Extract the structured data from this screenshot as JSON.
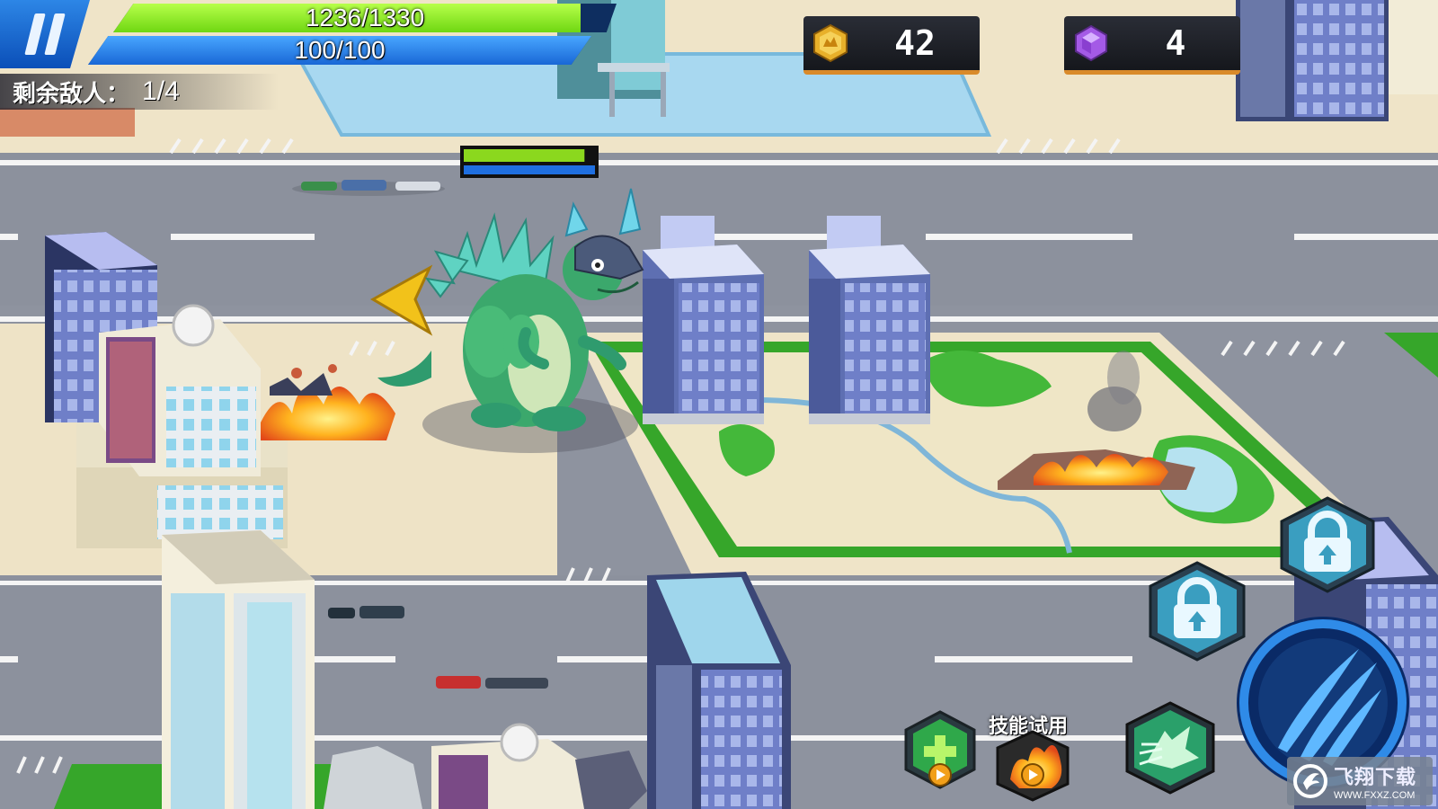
{
  "hud": {
    "hp": {
      "current": 1236,
      "max": 1330,
      "text": "1236/1330",
      "fraction": 0.929
    },
    "mp": {
      "current": 100,
      "max": 100,
      "text": "100/100",
      "fraction": 1.0
    },
    "enemies": {
      "label": "剩余敌人：",
      "value": "1/4"
    }
  },
  "currency": {
    "gold": {
      "icon": "gold-coin-icon",
      "value": "42"
    },
    "gems": {
      "icon": "purple-gem-icon",
      "value": "4"
    }
  },
  "player": {
    "hp_fraction": 0.92,
    "mp_fraction": 1.0
  },
  "skills": {
    "trial_label": "技能试用",
    "heal": {
      "icon": "heal-cross-icon",
      "state": "trial"
    },
    "fire": {
      "icon": "fire-blast-icon",
      "state": "trial"
    },
    "charge": {
      "icon": "dragon-charge-icon",
      "state": "ready"
    },
    "locked_1": {
      "icon": "lock-icon",
      "state": "locked"
    },
    "locked_2": {
      "icon": "lock-icon",
      "state": "locked"
    },
    "attack": {
      "icon": "claw-slash-icon",
      "state": "ready"
    }
  },
  "watermark": {
    "title": "飞翔下载",
    "url": "WWW.FXXZ.COM"
  },
  "colors": {
    "hp": "#7ad81a",
    "mp": "#1f6fe0",
    "ui_blue": "#0b4fb8",
    "gold": "#e8b02a",
    "gem": "#a45ae6"
  }
}
